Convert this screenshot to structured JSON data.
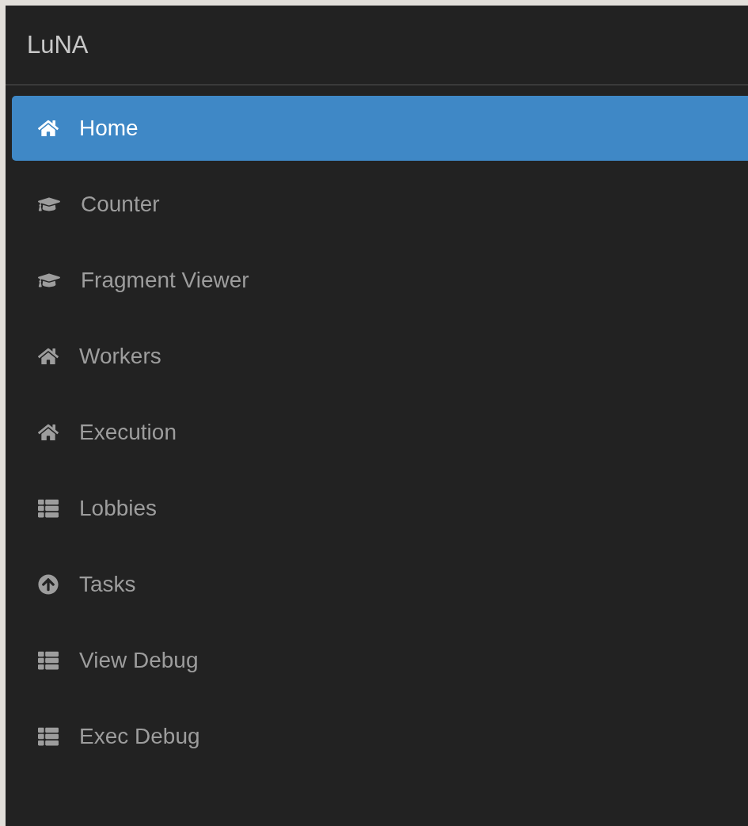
{
  "brand": "LuNA",
  "nav": [
    {
      "label": "Home",
      "kind": "home",
      "selected": true
    },
    {
      "label": "Counter",
      "kind": "cap",
      "selected": false
    },
    {
      "label": "Fragment Viewer",
      "kind": "cap",
      "selected": false
    },
    {
      "label": "Workers",
      "kind": "home",
      "selected": false
    },
    {
      "label": "Execution",
      "kind": "home",
      "selected": false
    },
    {
      "label": "Lobbies",
      "kind": "list",
      "selected": false
    },
    {
      "label": "Tasks",
      "kind": "upload",
      "selected": false
    },
    {
      "label": "View Debug",
      "kind": "list",
      "selected": false
    },
    {
      "label": "Exec Debug",
      "kind": "list",
      "selected": false
    }
  ]
}
